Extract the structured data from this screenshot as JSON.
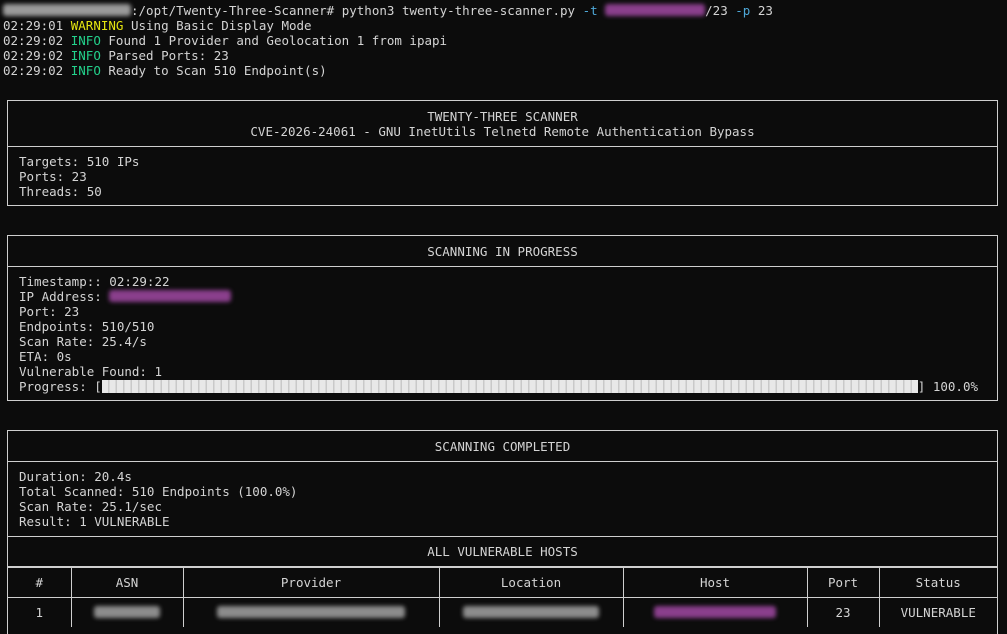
{
  "terminal": {
    "prompt": {
      "path_suffix": ":/opt/Twenty-Three-Scanner#",
      "command": "python3 twenty-three-scanner.py",
      "flag_t": "-t",
      "target_suffix": "/23",
      "flag_p": "-p",
      "port_arg": "23"
    },
    "log": [
      {
        "time": "02:29:01",
        "level": "WARNING",
        "message": "Using Basic Display Mode"
      },
      {
        "time": "02:29:02",
        "level": "INFO",
        "message": "Found 1 Provider and Geolocation 1 from ipapi"
      },
      {
        "time": "02:29:02",
        "level": "INFO",
        "message": "Parsed Ports: 23"
      },
      {
        "time": "02:29:02",
        "level": "INFO",
        "message": "Ready to Scan 510 Endpoint(s)"
      }
    ]
  },
  "header_panel": {
    "title": "TWENTY-THREE SCANNER",
    "subtitle": "CVE-2026-24061 - GNU InetUtils Telnetd Remote Authentication Bypass",
    "targets": "Targets: 510 IPs",
    "ports": "Ports: 23",
    "threads": "Threads: 50"
  },
  "progress_panel": {
    "title": "SCANNING IN PROGRESS",
    "timestamp": "Timestamp:: 02:29:22",
    "ip_label": "IP Address: ",
    "port": "Port: 23",
    "endpoints": "Endpoints: 510/510",
    "scan_rate": "Scan Rate: 25.4/s",
    "eta": "ETA: 0s",
    "vulnerable_found": "Vulnerable Found: 1",
    "progress_label": "Progress: [",
    "progress_close": "]",
    "progress_value": 1.0,
    "progress_percent": "100.0%"
  },
  "completed_panel": {
    "title": "SCANNING COMPLETED",
    "duration": "Duration: 20.4s",
    "total_scanned": "Total Scanned: 510 Endpoints (100.0%)",
    "scan_rate": "Scan Rate: 25.1/sec",
    "result": "Result: 1 VULNERABLE",
    "hosts_title": "ALL VULNERABLE HOSTS",
    "columns": [
      "#",
      "ASN",
      "Provider",
      "Location",
      "Host",
      "Port",
      "Status"
    ],
    "rows": [
      {
        "num": "1",
        "port": "23",
        "status": "VULNERABLE"
      }
    ]
  },
  "colors": {
    "background": "#0c0c0c",
    "text": "#d4d4d4",
    "warning": "#e5e510",
    "info": "#23d18b",
    "flag": "#4ea8d8",
    "border": "#cfcfcf"
  }
}
